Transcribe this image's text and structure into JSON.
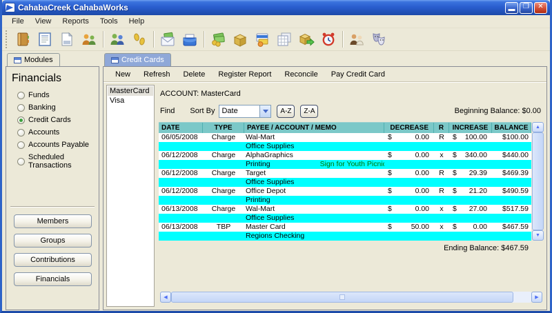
{
  "window": {
    "title": "CahabaCreek CahabaWorks",
    "controls": {
      "minimize": "_",
      "maximize": "□",
      "close": "✕"
    }
  },
  "menubar": {
    "items": [
      "File",
      "View",
      "Reports",
      "Tools",
      "Help"
    ]
  },
  "toolbar": {
    "icons": [
      "address-book",
      "notes-list",
      "new-document",
      "members-family",
      "people-group",
      "footprints",
      "mail-money",
      "card-file",
      "money-coins",
      "treasure-chest",
      "billing-cards",
      "table-grid",
      "distribution-chest",
      "alarm-clock",
      "staff-pair",
      "theater-masks"
    ]
  },
  "modules_panel": {
    "tab_label": "Modules",
    "heading": "Financials",
    "options": [
      {
        "label": "Funds",
        "selected": false
      },
      {
        "label": "Banking",
        "selected": false
      },
      {
        "label": "Credit Cards",
        "selected": true
      },
      {
        "label": "Accounts",
        "selected": false
      },
      {
        "label": "Accounts Payable",
        "selected": false
      },
      {
        "label": "Scheduled Transactions",
        "selected": false
      }
    ],
    "nav_buttons": [
      "Members",
      "Groups",
      "Contributions",
      "Financials"
    ]
  },
  "credit_cards": {
    "tab_label": "Credit Cards",
    "actions": [
      "New",
      "Refresh",
      "Delete",
      "Register Report",
      "Reconcile",
      "Pay Credit Card"
    ],
    "accounts": [
      {
        "name": "MasterCard",
        "selected": true
      },
      {
        "name": "Visa",
        "selected": false
      }
    ],
    "register": {
      "account_label": "ACCOUNT: MasterCard",
      "find_label": "Find",
      "sort_by_label": "Sort By",
      "sort_value": "Date",
      "sort_asc_label": "A-Z",
      "sort_desc_label": "Z-A",
      "beginning_balance": "Beginning Balance: $0.00",
      "ending_balance": "Ending Balance: $467.59",
      "table": {
        "headers": [
          "DATE",
          "TYPE",
          "PAYEE / ACCOUNT / MEMO",
          "DECREASE",
          "R",
          "INCREASE",
          "BALANCE"
        ],
        "currency_symbol": "$",
        "transactions": [
          {
            "date": "06/05/2008",
            "type": "Charge",
            "payee": "Wal-Mart",
            "decrease": "0.00",
            "reconciled": "R",
            "increase": "100.00",
            "balance": "$100.00",
            "account": "Office Supplies",
            "memo": ""
          },
          {
            "date": "06/12/2008",
            "type": "Charge",
            "payee": "AlphaGraphics",
            "decrease": "0.00",
            "reconciled": "x",
            "increase": "340.00",
            "balance": "$440.00",
            "account": "Printing",
            "memo": "Sign for Youth Picnic"
          },
          {
            "date": "06/12/2008",
            "type": "Charge",
            "payee": "Target",
            "decrease": "0.00",
            "reconciled": "R",
            "increase": "29.39",
            "balance": "$469.39",
            "account": "Office Supplies",
            "memo": ""
          },
          {
            "date": "06/12/2008",
            "type": "Charge",
            "payee": "Office Depot",
            "decrease": "0.00",
            "reconciled": "R",
            "increase": "21.20",
            "balance": "$490.59",
            "account": "Printing",
            "memo": ""
          },
          {
            "date": "06/13/2008",
            "type": "Charge",
            "payee": "Wal-Mart",
            "decrease": "0.00",
            "reconciled": "x",
            "increase": "27.00",
            "balance": "$517.59",
            "account": "Office Supplies",
            "memo": ""
          },
          {
            "date": "06/13/2008",
            "type": "TBP",
            "payee": "Master Card",
            "decrease": "50.00",
            "reconciled": "x",
            "increase": "0.00",
            "balance": "$467.59",
            "account": "Regions Checking",
            "memo": ""
          }
        ]
      }
    }
  },
  "colors": {
    "title_blue": "#2A5ECF",
    "tab_blue": "#8FA8D8",
    "header_teal": "#7BC8C8",
    "memo_cyan": "#00FFFF",
    "memo_green": "#007300",
    "chrome_beige": "#ECE9D8"
  }
}
